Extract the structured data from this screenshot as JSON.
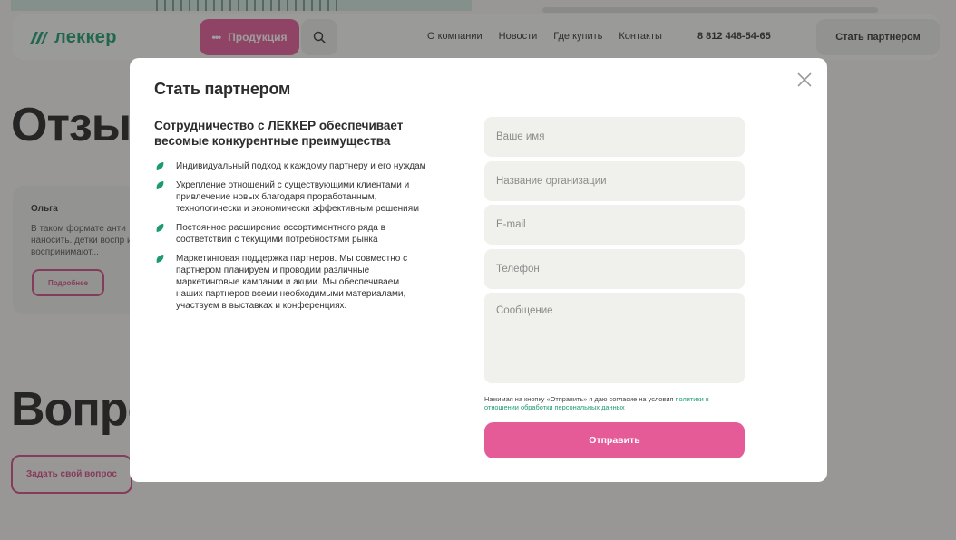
{
  "header": {
    "logo_text": "леккер",
    "products_label": "Продукция",
    "nav": [
      "О компании",
      "Новости",
      "Где купить",
      "Контакты"
    ],
    "phone": "8 812 448-54-65",
    "partner_button": "Стать партнером"
  },
  "background": {
    "reviews_heading": "Отзыв",
    "review": {
      "name": "Ольга",
      "text": "В таком формате анти наносить. детки воспр и воспринимают...",
      "more_label": "Подробнее"
    },
    "questions_heading": "Вопро",
    "ask_button": "Задать свой вопрос"
  },
  "modal": {
    "title": "Стать партнером",
    "subheading": "Сотрудничество с ЛЕККЕР обеспечивает весомые конкурентные преимущества",
    "benefits": [
      "Индивидуальный подход к каждому партнеру и его нуждам",
      "Укрепление отношений с существующими клиентами и привлечение новых благодаря проработанным, технологически и экономически эффективным решениям",
      "Постоянное расширение ассортиментного ряда в соответствии с текущими потребностями рынка",
      "Маркетинговая поддержка партнеров. Мы совместно с партнером планируем и проводим различные маркетинговые кампании и акции. Мы обеспечиваем наших партнеров всеми необходимыми материалами, участвуем в выставках и конференциях."
    ],
    "form": {
      "name_placeholder": "Ваше имя",
      "organization_placeholder": "Название организации",
      "email_placeholder": "E-mail",
      "phone_placeholder": "Телефон",
      "message_placeholder": "Сообщение"
    },
    "consent_text": "Нажимая на кнопку «Отправить» я даю согласие на условия ",
    "consent_link": "политики в отношении обработки персональных данных",
    "submit_label": "Отправить"
  },
  "colors": {
    "accent_pink": "#e45b98",
    "brand_green": "#1d9a72",
    "overlay": "rgba(40,40,40,0.45)"
  },
  "icons": [
    "logo-icon",
    "dots-icon",
    "search-icon",
    "close-icon",
    "leaf-bullet-icon"
  ]
}
